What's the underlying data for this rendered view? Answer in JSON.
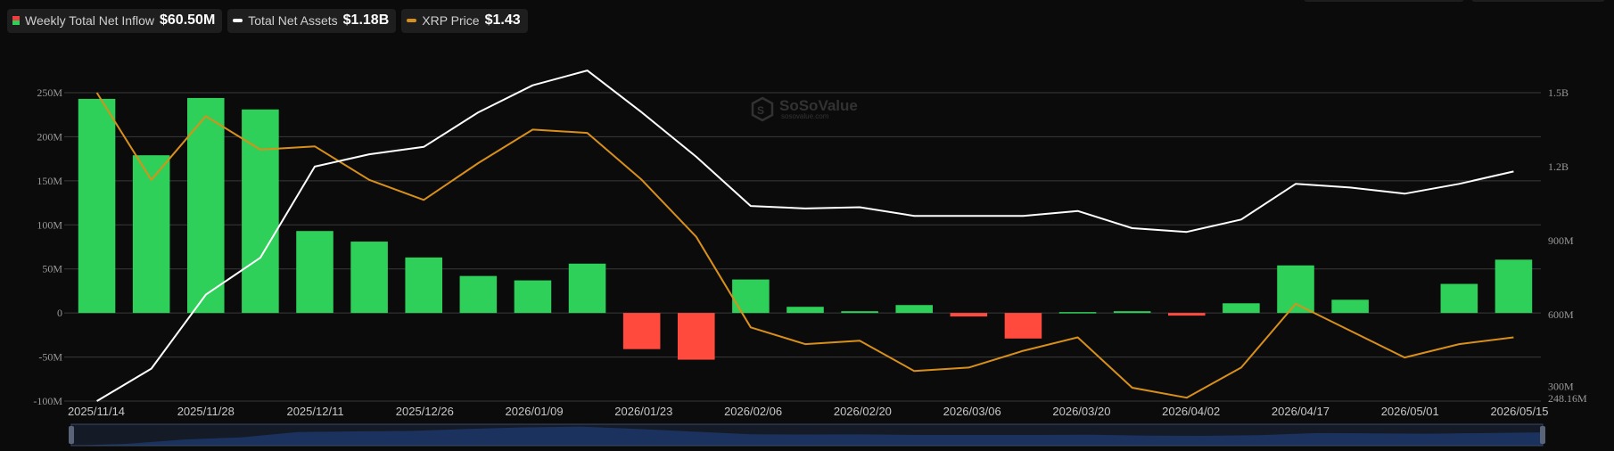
{
  "legend": {
    "inflow_label": "Weekly Total Net Inflow",
    "inflow_value": "$60.50M",
    "assets_label": "Total Net Assets",
    "assets_value": "$1.18B",
    "price_label": "XRP Price",
    "price_value": "$1.43"
  },
  "watermark": {
    "brand": "SoSoValue",
    "site": "sosovalue.com"
  },
  "colors": {
    "positive": "#2fd05a",
    "negative": "#ff4a3d",
    "assets_line": "#ffffff",
    "price_line": "#d8901a",
    "grid": "#3a3a3a",
    "navigator": "#1c3566"
  },
  "chart_data": {
    "type": "bar",
    "left_ticks": [
      "250M",
      "200M",
      "150M",
      "100M",
      "50M",
      "0",
      "-50M",
      "-100M"
    ],
    "right_ticks": [
      "1.5B",
      "1.2B",
      "900M",
      "600M",
      "300M",
      "248.16M"
    ],
    "x_tick_labels": [
      "2025/11/14",
      "2025/11/28",
      "2025/12/11",
      "2025/12/26",
      "2026/01/09",
      "2026/01/23",
      "2026/02/06",
      "2026/02/20",
      "2026/03/06",
      "2026/03/20",
      "2026/04/02",
      "2026/04/17",
      "2026/05/01",
      "2026/05/15"
    ],
    "ylim_left": [
      -100,
      250
    ],
    "ylim_right": [
      248.16,
      1500
    ],
    "grid": true,
    "legend_position": "top-left",
    "series": [
      {
        "name": "Weekly Total Net Inflow",
        "type": "bar",
        "unit": "M",
        "values": [
          243,
          179,
          244,
          231,
          93,
          81,
          63,
          42,
          37,
          56,
          -41,
          -53,
          38,
          7,
          2,
          9,
          -4,
          -29,
          1,
          2,
          -3,
          11,
          54,
          15,
          0,
          33,
          60.5
        ]
      },
      {
        "name": "Total Net Assets",
        "type": "line",
        "unit": "M",
        "values": [
          248.16,
          380,
          680,
          830,
          1200,
          1250,
          1280,
          1420,
          1530,
          1590,
          1420,
          1240,
          1040,
          1030,
          1035,
          1000,
          1000,
          1000,
          1020,
          950,
          935,
          985,
          1130,
          1115,
          1090,
          1130,
          1180
        ]
      },
      {
        "name": "XRP Price",
        "type": "line",
        "unit": "$",
        "values": [
          2.3,
          2.04,
          2.23,
          2.13,
          2.14,
          2.04,
          1.98,
          2.09,
          2.19,
          2.18,
          2.04,
          1.87,
          1.6,
          1.55,
          1.56,
          1.47,
          1.48,
          1.53,
          1.57,
          1.42,
          1.39,
          1.48,
          1.67,
          1.59,
          1.51,
          1.55,
          1.57
        ]
      }
    ]
  }
}
